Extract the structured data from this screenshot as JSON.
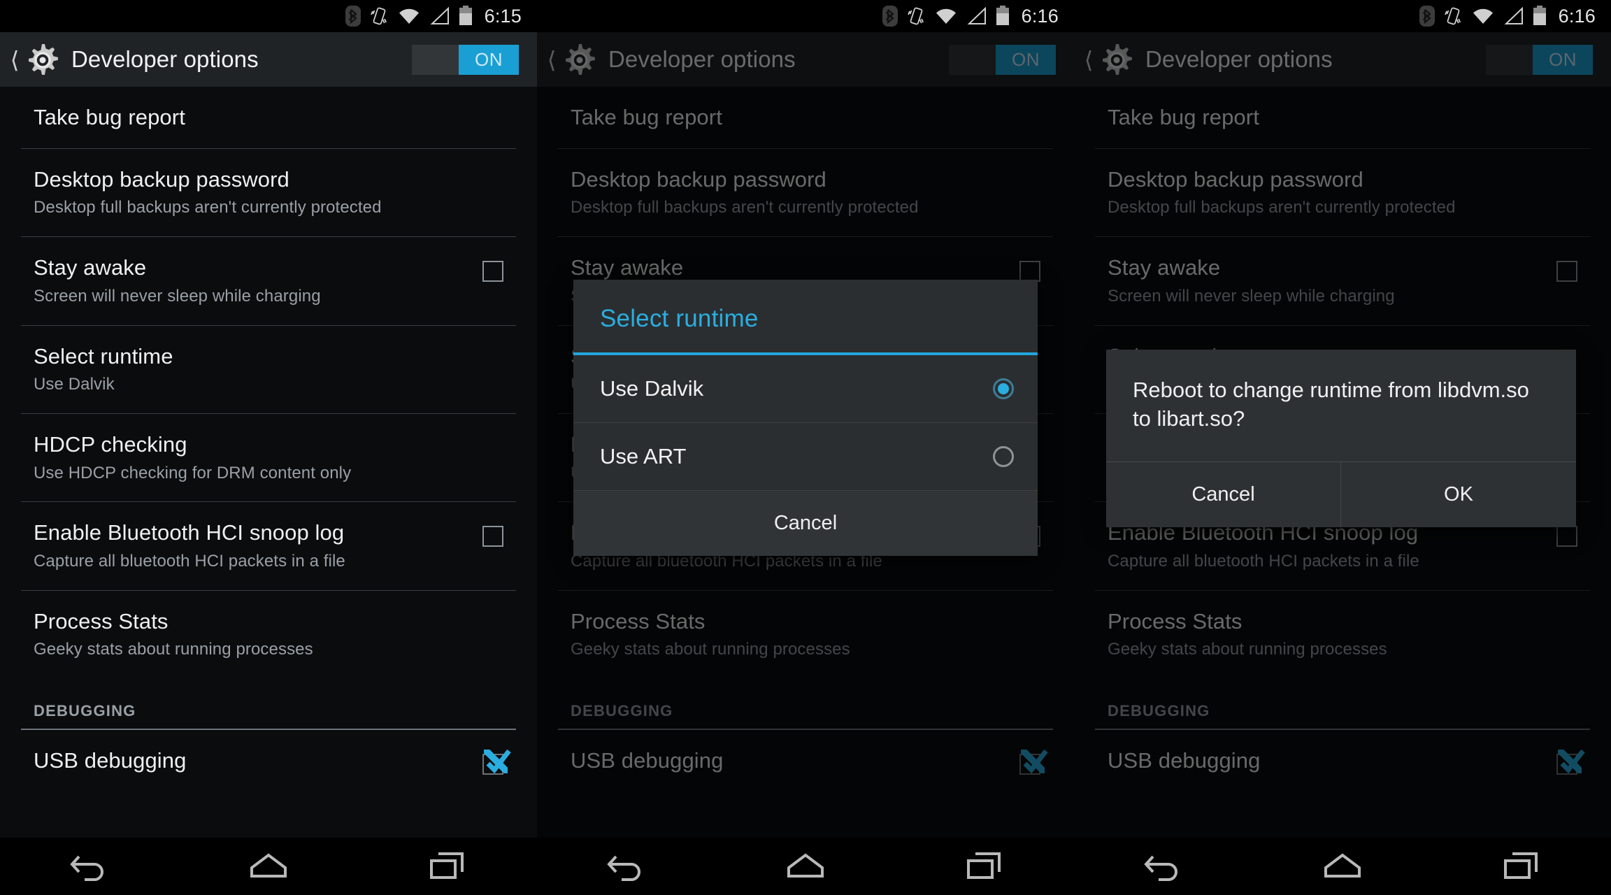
{
  "app": {
    "title": "Developer options",
    "toggle_label": "ON"
  },
  "status_bar": {
    "icons": [
      "bluetooth-icon",
      "vibrate-icon",
      "wifi-icon",
      "cellular-signal-icon",
      "battery-icon"
    ],
    "times": [
      "6:15",
      "6:16",
      "6:16"
    ]
  },
  "settings": {
    "items": [
      {
        "title": "Take bug report",
        "sub": "",
        "control": "none"
      },
      {
        "title": "Desktop backup password",
        "sub": "Desktop full backups aren't currently protected",
        "control": "none"
      },
      {
        "title": "Stay awake",
        "sub": "Screen will never sleep while charging",
        "control": "checkbox",
        "checked": false
      },
      {
        "title": "Select runtime",
        "sub": "Use Dalvik",
        "control": "none"
      },
      {
        "title": "HDCP checking",
        "sub": "Use HDCP checking for DRM content only",
        "control": "none"
      },
      {
        "title": "Enable Bluetooth HCI snoop log",
        "sub": "Capture all bluetooth HCI packets in a file",
        "control": "checkbox",
        "checked": false
      },
      {
        "title": "Process Stats",
        "sub": "Geeky stats about running processes",
        "control": "none"
      }
    ],
    "section_header": "DEBUGGING",
    "debug_items": [
      {
        "title": "USB debugging",
        "sub": "",
        "control": "checkbox",
        "checked": true
      }
    ]
  },
  "runtime_dialog": {
    "title": "Select runtime",
    "options": [
      {
        "label": "Use Dalvik",
        "selected": true
      },
      {
        "label": "Use ART",
        "selected": false
      }
    ],
    "cancel_label": "Cancel"
  },
  "reboot_dialog": {
    "message": "Reboot to change runtime from libdvm.so to libart.so?",
    "cancel_label": "Cancel",
    "ok_label": "OK"
  },
  "nav_bar": {
    "buttons": [
      "back-icon",
      "home-icon",
      "recents-icon"
    ]
  },
  "colors": {
    "accent": "#2aaee0",
    "toggle_on": "#1a9fd4",
    "action_bar": "#1f2326",
    "list_bg": "#0a0c0e",
    "dialog_bg": "#2b2e31",
    "subtext": "#9aa0a6"
  }
}
